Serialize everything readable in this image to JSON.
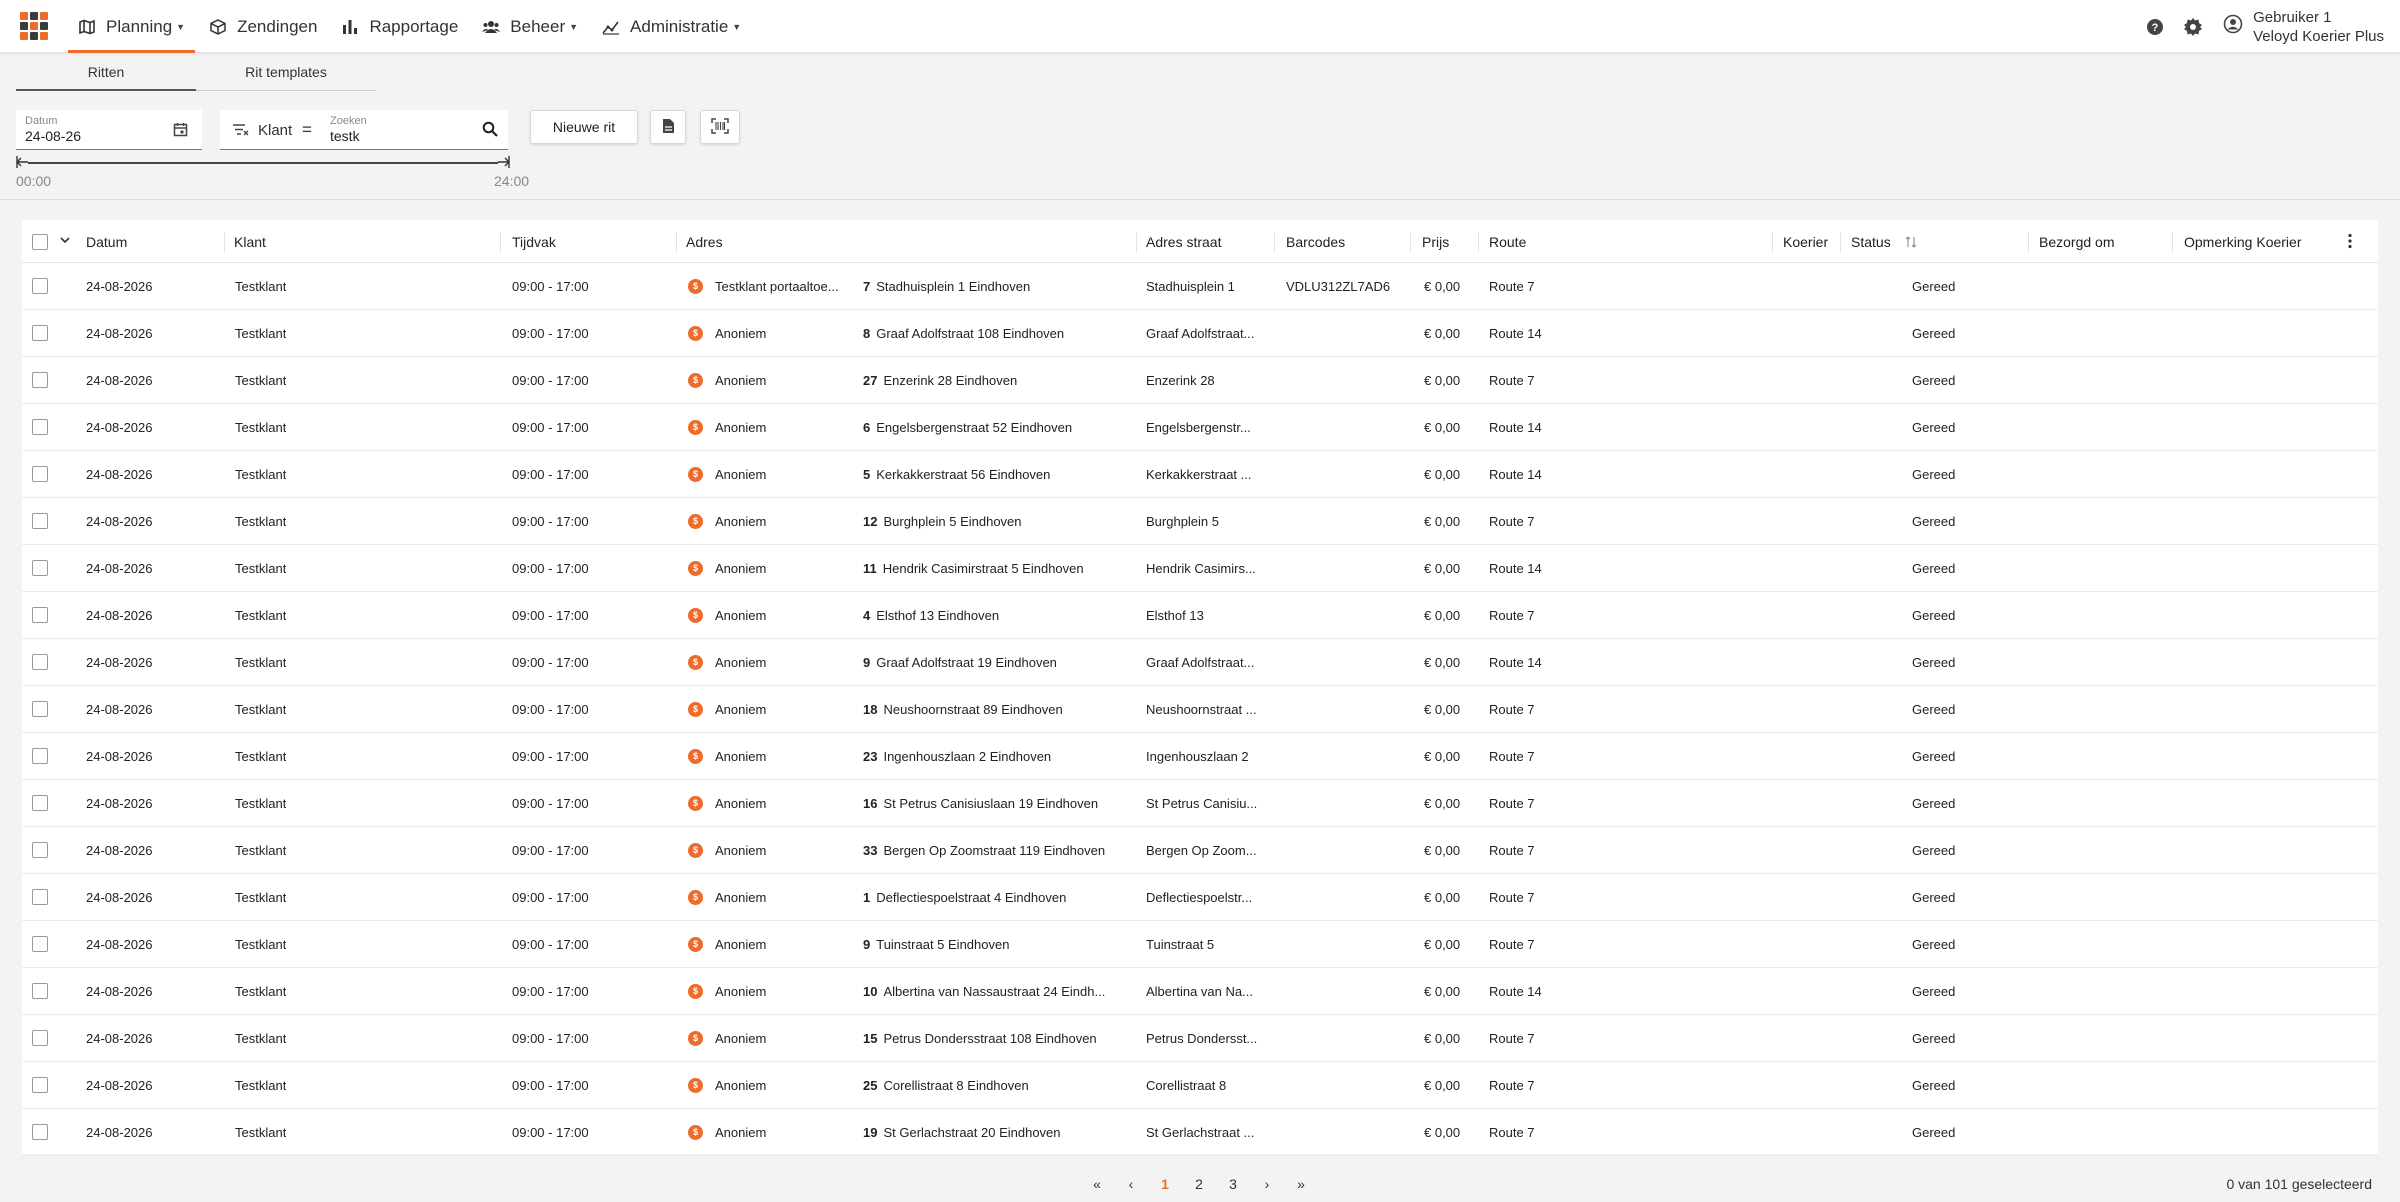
{
  "nav": {
    "items": [
      {
        "label": "Planning",
        "icon": "map-icon",
        "dropdown": true,
        "active": true
      },
      {
        "label": "Zendingen",
        "icon": "package-icon",
        "dropdown": false,
        "active": false
      },
      {
        "label": "Rapportage",
        "icon": "bar-chart-icon",
        "dropdown": false,
        "active": false
      },
      {
        "label": "Beheer",
        "icon": "group-icon",
        "dropdown": true,
        "active": false
      },
      {
        "label": "Administratie",
        "icon": "finance-icon",
        "dropdown": true,
        "active": false
      }
    ],
    "user_name": "Gebruiker 1",
    "user_org": "Veloyd Koerier Plus"
  },
  "tabs": [
    "Ritten",
    "Rit templates"
  ],
  "filters": {
    "date_label": "Datum",
    "date_value": "24-08-26",
    "field_name": "Klant",
    "operator": "=",
    "search_label": "Zoeken",
    "search_value": "testk",
    "new_button": "Nieuwe rit",
    "time_start": "00:00",
    "time_end": "24:00"
  },
  "table": {
    "headers": {
      "datum": "Datum",
      "klant": "Klant",
      "tijdvak": "Tijdvak",
      "adres": "Adres",
      "adres_straat": "Adres straat",
      "barcodes": "Barcodes",
      "prijs": "Prijs",
      "route": "Route",
      "koerier": "Koerier",
      "status": "Status",
      "bezorgd_om": "Bezorgd om",
      "opmerking": "Opmerking Koerier"
    },
    "rows": [
      {
        "datum": "24-08-2026",
        "klant": "Testklant",
        "tijdvak": "09:00 - 17:00",
        "naam": "Testklant portaaltoe...",
        "num": "7",
        "adres": "Stadhuisplein 1 Eindhoven",
        "straat": "Stadhuisplein 1",
        "barcode": "VDLU312ZL7AD6",
        "prijs": "€ 0,00",
        "route": "Route 7",
        "status": "Gereed"
      },
      {
        "datum": "24-08-2026",
        "klant": "Testklant",
        "tijdvak": "09:00 - 17:00",
        "naam": "Anoniem",
        "num": "8",
        "adres": "Graaf Adolfstraat 108 Eindhoven",
        "straat": "Graaf Adolfstraat...",
        "barcode": "",
        "prijs": "€ 0,00",
        "route": "Route 14",
        "status": "Gereed"
      },
      {
        "datum": "24-08-2026",
        "klant": "Testklant",
        "tijdvak": "09:00 - 17:00",
        "naam": "Anoniem",
        "num": "27",
        "adres": "Enzerink 28 Eindhoven",
        "straat": "Enzerink 28",
        "barcode": "",
        "prijs": "€ 0,00",
        "route": "Route 7",
        "status": "Gereed"
      },
      {
        "datum": "24-08-2026",
        "klant": "Testklant",
        "tijdvak": "09:00 - 17:00",
        "naam": "Anoniem",
        "num": "6",
        "adres": "Engelsbergenstraat 52 Eindhoven",
        "straat": "Engelsbergenstr...",
        "barcode": "",
        "prijs": "€ 0,00",
        "route": "Route 14",
        "status": "Gereed"
      },
      {
        "datum": "24-08-2026",
        "klant": "Testklant",
        "tijdvak": "09:00 - 17:00",
        "naam": "Anoniem",
        "num": "5",
        "adres": "Kerkakkerstraat 56 Eindhoven",
        "straat": "Kerkakkerstraat ...",
        "barcode": "",
        "prijs": "€ 0,00",
        "route": "Route 14",
        "status": "Gereed"
      },
      {
        "datum": "24-08-2026",
        "klant": "Testklant",
        "tijdvak": "09:00 - 17:00",
        "naam": "Anoniem",
        "num": "12",
        "adres": "Burghplein 5 Eindhoven",
        "straat": "Burghplein 5",
        "barcode": "",
        "prijs": "€ 0,00",
        "route": "Route 7",
        "status": "Gereed"
      },
      {
        "datum": "24-08-2026",
        "klant": "Testklant",
        "tijdvak": "09:00 - 17:00",
        "naam": "Anoniem",
        "num": "11",
        "adres": "Hendrik Casimirstraat 5 Eindhoven",
        "straat": "Hendrik Casimirs...",
        "barcode": "",
        "prijs": "€ 0,00",
        "route": "Route 14",
        "status": "Gereed"
      },
      {
        "datum": "24-08-2026",
        "klant": "Testklant",
        "tijdvak": "09:00 - 17:00",
        "naam": "Anoniem",
        "num": "4",
        "adres": "Elsthof 13 Eindhoven",
        "straat": "Elsthof 13",
        "barcode": "",
        "prijs": "€ 0,00",
        "route": "Route 7",
        "status": "Gereed"
      },
      {
        "datum": "24-08-2026",
        "klant": "Testklant",
        "tijdvak": "09:00 - 17:00",
        "naam": "Anoniem",
        "num": "9",
        "adres": "Graaf Adolfstraat 19 Eindhoven",
        "straat": "Graaf Adolfstraat...",
        "barcode": "",
        "prijs": "€ 0,00",
        "route": "Route 14",
        "status": "Gereed"
      },
      {
        "datum": "24-08-2026",
        "klant": "Testklant",
        "tijdvak": "09:00 - 17:00",
        "naam": "Anoniem",
        "num": "18",
        "adres": "Neushoornstraat 89 Eindhoven",
        "straat": "Neushoornstraat ...",
        "barcode": "",
        "prijs": "€ 0,00",
        "route": "Route 7",
        "status": "Gereed"
      },
      {
        "datum": "24-08-2026",
        "klant": "Testklant",
        "tijdvak": "09:00 - 17:00",
        "naam": "Anoniem",
        "num": "23",
        "adres": "Ingenhouszlaan 2 Eindhoven",
        "straat": "Ingenhouszlaan 2",
        "barcode": "",
        "prijs": "€ 0,00",
        "route": "Route 7",
        "status": "Gereed"
      },
      {
        "datum": "24-08-2026",
        "klant": "Testklant",
        "tijdvak": "09:00 - 17:00",
        "naam": "Anoniem",
        "num": "16",
        "adres": "St Petrus Canisiuslaan 19 Eindhoven",
        "straat": "St Petrus Canisiu...",
        "barcode": "",
        "prijs": "€ 0,00",
        "route": "Route 7",
        "status": "Gereed"
      },
      {
        "datum": "24-08-2026",
        "klant": "Testklant",
        "tijdvak": "09:00 - 17:00",
        "naam": "Anoniem",
        "num": "33",
        "adres": "Bergen Op Zoomstraat 119 Eindhoven",
        "straat": "Bergen Op Zoom...",
        "barcode": "",
        "prijs": "€ 0,00",
        "route": "Route 7",
        "status": "Gereed"
      },
      {
        "datum": "24-08-2026",
        "klant": "Testklant",
        "tijdvak": "09:00 - 17:00",
        "naam": "Anoniem",
        "num": "1",
        "adres": "Deflectiespoelstraat 4 Eindhoven",
        "straat": "Deflectiespoelstr...",
        "barcode": "",
        "prijs": "€ 0,00",
        "route": "Route 7",
        "status": "Gereed"
      },
      {
        "datum": "24-08-2026",
        "klant": "Testklant",
        "tijdvak": "09:00 - 17:00",
        "naam": "Anoniem",
        "num": "9",
        "adres": "Tuinstraat 5 Eindhoven",
        "straat": "Tuinstraat 5",
        "barcode": "",
        "prijs": "€ 0,00",
        "route": "Route 7",
        "status": "Gereed"
      },
      {
        "datum": "24-08-2026",
        "klant": "Testklant",
        "tijdvak": "09:00 - 17:00",
        "naam": "Anoniem",
        "num": "10",
        "adres": "Albertina van Nassaustraat 24 Eindh...",
        "straat": "Albertina van Na...",
        "barcode": "",
        "prijs": "€ 0,00",
        "route": "Route 14",
        "status": "Gereed"
      },
      {
        "datum": "24-08-2026",
        "klant": "Testklant",
        "tijdvak": "09:00 - 17:00",
        "naam": "Anoniem",
        "num": "15",
        "adres": "Petrus Dondersstraat 108 Eindhoven",
        "straat": "Petrus Dondersst...",
        "barcode": "",
        "prijs": "€ 0,00",
        "route": "Route 7",
        "status": "Gereed"
      },
      {
        "datum": "24-08-2026",
        "klant": "Testklant",
        "tijdvak": "09:00 - 17:00",
        "naam": "Anoniem",
        "num": "25",
        "adres": "Corellistraat 8 Eindhoven",
        "straat": "Corellistraat 8",
        "barcode": "",
        "prijs": "€ 0,00",
        "route": "Route 7",
        "status": "Gereed"
      },
      {
        "datum": "24-08-2026",
        "klant": "Testklant",
        "tijdvak": "09:00 - 17:00",
        "naam": "Anoniem",
        "num": "19",
        "adres": "St Gerlachstraat 20 Eindhoven",
        "straat": "St Gerlachstraat ...",
        "barcode": "",
        "prijs": "€ 0,00",
        "route": "Route 7",
        "status": "Gereed"
      }
    ]
  },
  "pagination": {
    "pages": [
      "1",
      "2",
      "3"
    ],
    "current": "1",
    "selected_text": "0 van 101 geselecteerd"
  },
  "colors": {
    "accent": "#ec6b2d",
    "background": "#f3f3f3"
  }
}
